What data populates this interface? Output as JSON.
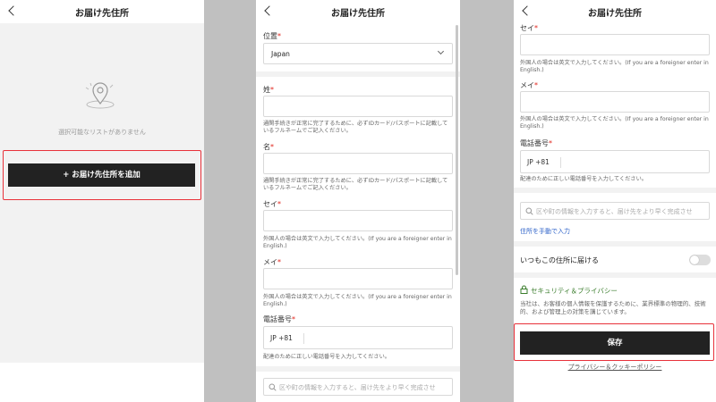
{
  "header_title": "お届け先住所",
  "panel1": {
    "empty_text": "選択可能なリストがありません",
    "add_button": "+ お届け先住所を追加"
  },
  "panel2": {
    "location_label": "位置",
    "location_value": "Japan",
    "sei_label": "姓",
    "sei_hint": "通関手続きが正常に完了するために、必ずIDカード/パスポートに記載しているフルネームでご記入ください。",
    "mei_label": "名",
    "mei_hint": "通関手続きが正常に完了するために、必ずIDカード/パスポートに記載しているフルネームでご記入ください。",
    "sei_kana_label": "セイ",
    "sei_kana_hint": "外国人の場合は英文で入力してください。(If you are a foreigner enter in English.)",
    "mei_kana_label": "メイ",
    "mei_kana_hint": "外国人の場合は英文で入力してください。(If you are a foreigner enter in English.)",
    "phone_label": "電話番号",
    "phone_prefix": "JP +81",
    "phone_hint": "配達のために正しい電話番号を入力してください。",
    "search_placeholder": "区や町の情報を入力すると、届け先をより早く完成させ"
  },
  "panel3": {
    "sei_kana_label": "セイ",
    "sei_kana_hint": "外国人の場合は英文で入力してください。(If you are a foreigner enter in English.)",
    "mei_kana_label": "メイ",
    "mei_kana_hint": "外国人の場合は英文で入力してください。(If you are a foreigner enter in English.)",
    "phone_label": "電話番号",
    "phone_prefix": "JP +81",
    "phone_hint": "配達のために正しい電話番号を入力してください。",
    "search_placeholder": "区や町の情報を入力すると、届け先をより早く完成させ",
    "manual_link": "住所を手動で入力",
    "default_toggle_label": "いつもこの住所に届ける",
    "security_title": "セキュリティ＆プライバシー",
    "security_text": "当社は、お客様の個人情報を保護するために、業界標準の物理的、技術的、および管理上の対策を講じています。",
    "save_button": "保存",
    "privacy_link": "プライバシー＆クッキーポリシー"
  },
  "colors": {
    "accent_red": "#e8313a",
    "dark_button": "#222222",
    "link_blue": "#2f63c9",
    "security_green": "#3a7d2c"
  }
}
